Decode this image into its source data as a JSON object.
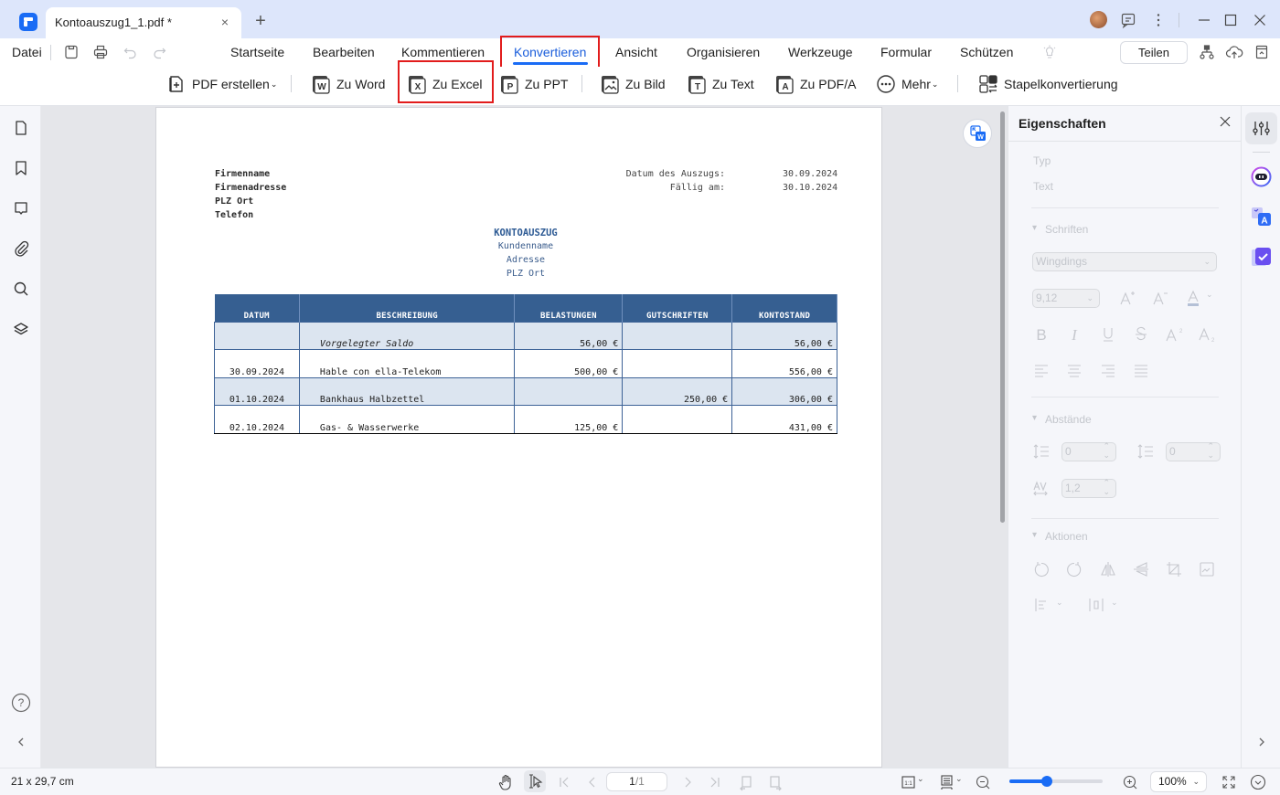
{
  "window": {
    "tab_title": "Kontoauszug1_1.pdf *",
    "tab_close": "×",
    "new_tab": "+"
  },
  "menu": {
    "file": "Datei",
    "tabs": [
      {
        "label": "Startseite",
        "active": false
      },
      {
        "label": "Bearbeiten",
        "active": false
      },
      {
        "label": "Kommentieren",
        "active": false
      },
      {
        "label": "Konvertieren",
        "active": true
      },
      {
        "label": "Ansicht",
        "active": false
      },
      {
        "label": "Organisieren",
        "active": false
      },
      {
        "label": "Werkzeuge",
        "active": false
      },
      {
        "label": "Formular",
        "active": false
      },
      {
        "label": "Schützen",
        "active": false
      }
    ],
    "share_label": "Teilen"
  },
  "toolbar": {
    "items": [
      {
        "label": "PDF erstellen",
        "icon": "pdf-create-icon",
        "dropdown": true
      },
      {
        "label": "Zu Word",
        "icon": "word-icon",
        "glyph": "W"
      },
      {
        "label": "Zu Excel",
        "icon": "excel-icon",
        "glyph": "X",
        "highlighted": true
      },
      {
        "label": "Zu PPT",
        "icon": "ppt-icon",
        "glyph": "P"
      },
      {
        "label": "Zu Bild",
        "icon": "image-icon"
      },
      {
        "label": "Zu Text",
        "icon": "text-icon",
        "glyph": "T"
      },
      {
        "label": "Zu PDF/A",
        "icon": "pdfa-icon",
        "glyph": "A"
      },
      {
        "label": "Mehr",
        "icon": "more-icon",
        "dropdown": true
      },
      {
        "label": "Stapelkonvertierung",
        "icon": "batch-convert-icon"
      }
    ]
  },
  "document": {
    "company": [
      "Firmenname",
      "Firmenadresse",
      "PLZ Ort",
      "Telefon"
    ],
    "meta": [
      {
        "label": "Datum des Auszugs:",
        "value": "30.09.2024"
      },
      {
        "label": "Fällig am:",
        "value": "30.10.2024"
      }
    ],
    "title": "KONTOAUSZUG",
    "customer": [
      "Kundenname",
      "Adresse",
      "PLZ Ort"
    ],
    "table": {
      "headers": [
        "DATUM",
        "BESCHREIBUNG",
        "BELASTUNGEN",
        "GUTSCHRIFTEN",
        "KONTOSTAND"
      ],
      "rows": [
        {
          "date": "",
          "description": "Vorgelegter Saldo",
          "debit": "56,00 €",
          "credit": "",
          "balance": "56,00 €",
          "italic": true
        },
        {
          "date": "30.09.2024",
          "description": "Hable con ella-Telekom",
          "debit": "500,00 €",
          "credit": "",
          "balance": "556,00 €"
        },
        {
          "date": "01.10.2024",
          "description": "Bankhaus Halbzettel",
          "debit": "",
          "credit": "250,00 €",
          "balance": "306,00 €"
        },
        {
          "date": "02.10.2024",
          "description": "Gas- & Wasserwerke",
          "debit": "125,00 €",
          "credit": "",
          "balance": "431,00 €"
        }
      ]
    }
  },
  "properties": {
    "title": "Eigenschaften",
    "type_label": "Typ",
    "type_value": "Text",
    "fonts_section": "Schriften",
    "font_family": "Wingdings",
    "font_size": "9,12",
    "spacing_section": "Abstände",
    "line_spacing": "0",
    "paragraph_spacing": "0",
    "char_spacing": "1,2",
    "actions_section": "Aktionen"
  },
  "statusbar": {
    "page_size": "21 x 29,7 cm",
    "page_current": "1",
    "page_total": "/1",
    "zoom_level": "100%",
    "zoom_fraction": 0.4
  },
  "colors": {
    "accent": "#1a6cf5",
    "highlight_box": "#e21c1c",
    "table_header": "#365f91",
    "table_alt_row": "#dce5f0"
  }
}
